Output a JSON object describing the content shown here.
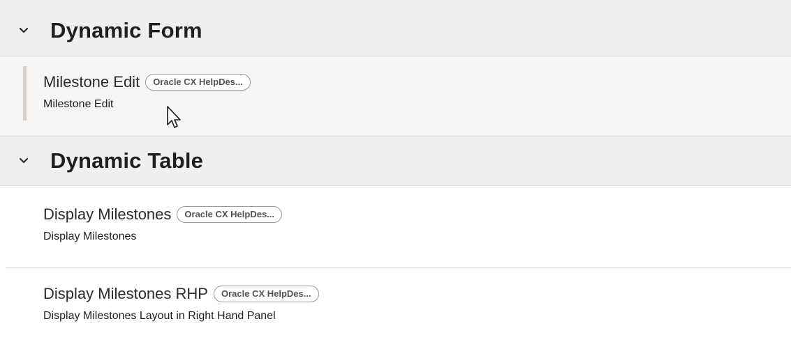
{
  "sections": [
    {
      "title": "Dynamic Form",
      "items": [
        {
          "name": "Milestone Edit",
          "badge": "Oracle CX HelpDes...",
          "description": "Milestone Edit",
          "selected": true
        }
      ]
    },
    {
      "title": "Dynamic Table",
      "items": [
        {
          "name": "Display Milestones",
          "badge": "Oracle CX HelpDes...",
          "description": "Display Milestones",
          "selected": false
        },
        {
          "name": "Display Milestones RHP",
          "badge": "Oracle CX HelpDes...",
          "description": "Display Milestones Layout in Right Hand Panel",
          "selected": false
        }
      ]
    }
  ],
  "icons": {
    "section_toggle": "chevron-down-icon",
    "pointer": "mouse-cursor-icon"
  }
}
